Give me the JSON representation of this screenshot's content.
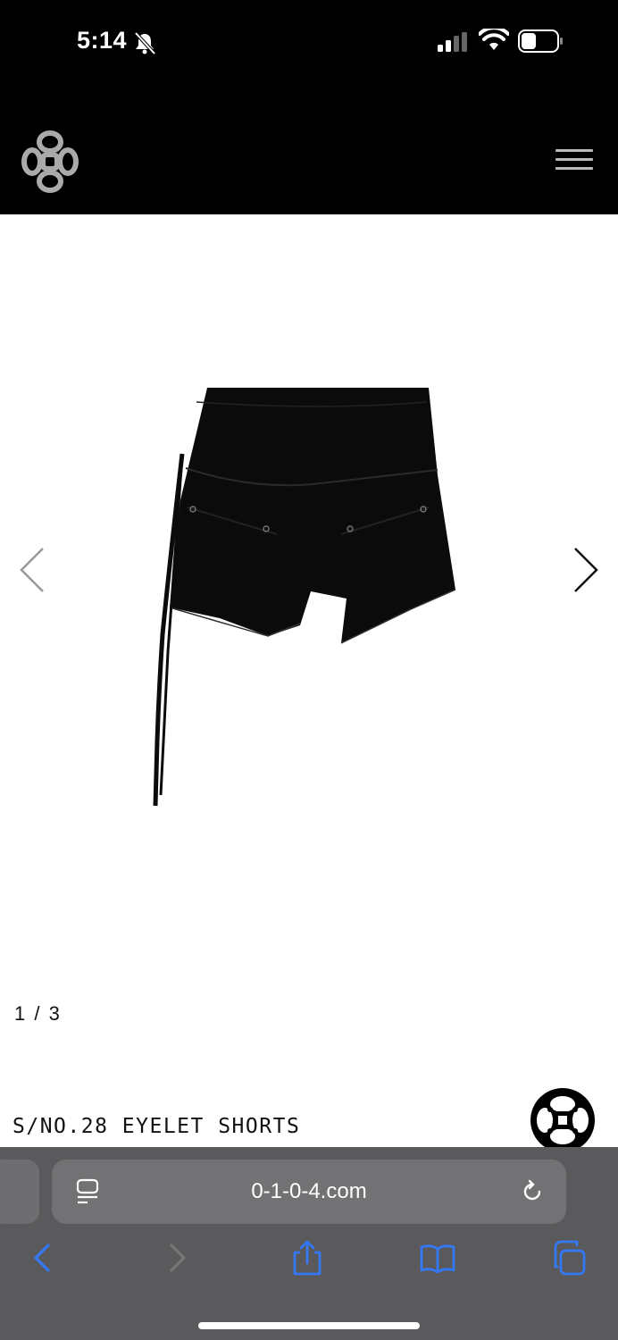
{
  "status_bar": {
    "time": "5:14"
  },
  "header": {
    "logo_icon": "quatrefoil-logo-icon",
    "menu_icon": "hamburger-menu-icon"
  },
  "carousel": {
    "page_indicator": "1 / 3",
    "prev_icon": "chevron-left-icon",
    "next_icon": "chevron-right-icon",
    "image_subject": "black shorts"
  },
  "product": {
    "title": "S/NO.28 EYELET SHORTS"
  },
  "browser": {
    "url": "0-1-0-4.com",
    "toolbar": [
      "back-icon",
      "forward-icon",
      "share-icon",
      "bookmarks-icon",
      "tabs-icon"
    ],
    "accent_color": "#3478f6"
  }
}
